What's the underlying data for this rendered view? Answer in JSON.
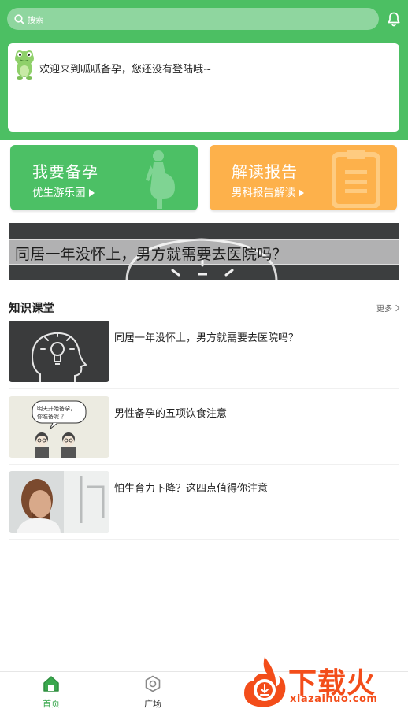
{
  "search": {
    "placeholder": "搜索"
  },
  "welcome": {
    "text": "欢迎来到呱呱备孕，您还没有登陆哦~"
  },
  "features": [
    {
      "title": "我要备孕",
      "subtitle": "优生游乐园"
    },
    {
      "title": "解读报告",
      "subtitle": "男科报告解读"
    }
  ],
  "banner": {
    "text": "同居一年没怀上，男方就需要去医院吗？"
  },
  "knowledge": {
    "title": "知识课堂",
    "more": "更多",
    "articles": [
      {
        "title": "同居一年没怀上，男方就需要去医院吗？"
      },
      {
        "title": "男性备孕的五项饮食注意"
      },
      {
        "title": "怕生育力下降？这四点值得你注意"
      }
    ]
  },
  "comic": {
    "bubble": "明天开始备孕，你准备呢 ？"
  },
  "nav": {
    "home": "首页",
    "square": "广场"
  },
  "watermark": {
    "brand": "下载火",
    "url": "xiazaihuo.com"
  },
  "colors": {
    "primary": "#4cbf63",
    "orange": "#fdb14b",
    "watermark": "#f34d1a"
  }
}
